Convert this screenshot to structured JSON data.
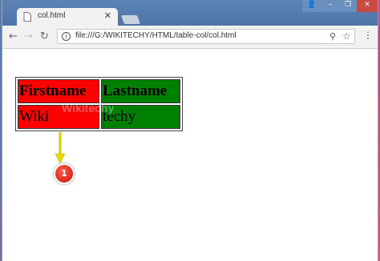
{
  "browser": {
    "tab_title": "col.html",
    "tab_close": "✕",
    "url": "file:///G:/WIKITECHY/HTML/table-col/col.html",
    "info_glyph": "i",
    "window_controls": {
      "user": "👤",
      "minimize": "–",
      "maximize": "❐",
      "close": "✕"
    }
  },
  "table": {
    "headers": [
      "Firstname",
      "Lastname"
    ],
    "row": [
      "Wiki",
      "techy"
    ],
    "column_colors": [
      "#ff0000",
      "#008000"
    ]
  },
  "annotation": {
    "badge_number": "1",
    "watermark": "Wikitechy"
  },
  "icons": [
    "back-arrow-icon",
    "forward-arrow-icon",
    "reload-icon",
    "info-icon",
    "zoom-icon",
    "star-icon",
    "menu-icon",
    "close-icon"
  ]
}
